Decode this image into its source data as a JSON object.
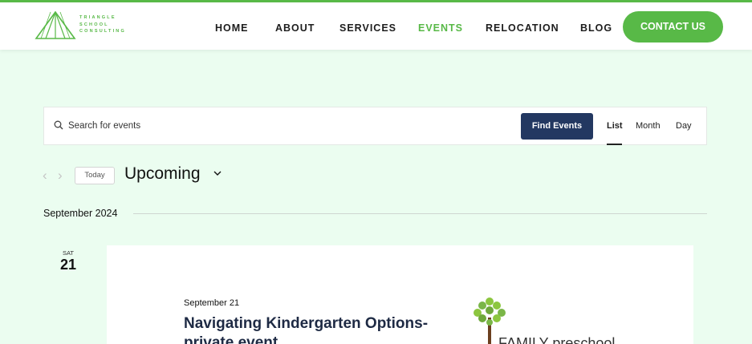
{
  "header": {
    "logo": {
      "lines": [
        "TRIANGLE",
        "SCHOOL",
        "CONSULTING"
      ]
    },
    "nav": [
      {
        "label": "HOME"
      },
      {
        "label": "ABOUT"
      },
      {
        "label": "SERVICES"
      },
      {
        "label": "EVENTS",
        "active": true
      },
      {
        "label": "RELOCATION"
      },
      {
        "label": "BLOG"
      }
    ],
    "contact_label": "CONTACT US"
  },
  "search": {
    "placeholder": "Search for events",
    "find_label": "Find Events",
    "views": [
      "List",
      "Month",
      "Day"
    ],
    "active_view": "List"
  },
  "toolbar": {
    "prev_icon": "chevron-left-icon",
    "next_icon": "chevron-right-icon",
    "today_label": "Today",
    "range_label": "Upcoming"
  },
  "events": {
    "month_label": "September 2024",
    "items": [
      {
        "dow": "SAT",
        "day": "21",
        "date_text": "September 21",
        "title": "Navigating Kindergarten Options-private event",
        "image_text": "FAMILY preschool"
      }
    ]
  },
  "colors": {
    "brand_green": "#58b947",
    "navy": "#233861",
    "page_bg": "#ebfdf0"
  }
}
